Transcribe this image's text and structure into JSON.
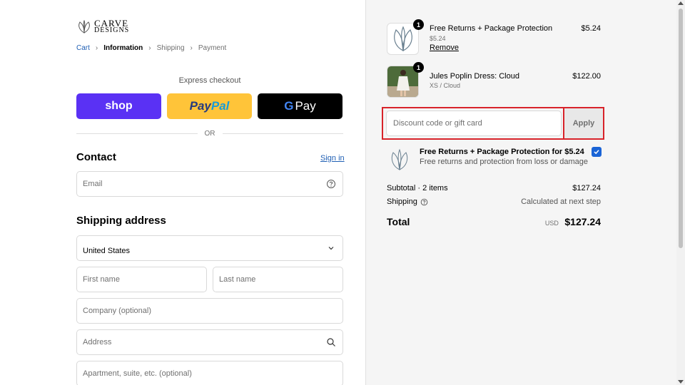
{
  "logo": {
    "line1": "CARVE",
    "line2": "DESIGNS"
  },
  "breadcrumb": [
    {
      "label": "Cart",
      "state": "link"
    },
    {
      "label": "Information",
      "state": "current"
    },
    {
      "label": "Shipping",
      "state": "inactive"
    },
    {
      "label": "Payment",
      "state": "inactive"
    }
  ],
  "express": {
    "label": "Express checkout",
    "shop": "shop",
    "paypal_a": "Pay",
    "paypal_b": "Pal",
    "gpay_g": "G",
    "gpay_text": "Pay",
    "or": "OR"
  },
  "contact": {
    "title": "Contact",
    "signin": "Sign in",
    "email_placeholder": "Email"
  },
  "shipping": {
    "title": "Shipping address",
    "country": "United States",
    "first_name_placeholder": "First name",
    "last_name_placeholder": "Last name",
    "company_placeholder": "Company (optional)",
    "address_placeholder": "Address",
    "apartment_placeholder": "Apartment, suite, etc. (optional)"
  },
  "cart": {
    "items": [
      {
        "title": "Free Returns + Package Protection",
        "sub": "$5.24",
        "action": "Remove",
        "price": "$5.24",
        "qty": "1",
        "icon": "leaf-logo-icon"
      },
      {
        "title": "Jules Poplin Dress: Cloud",
        "sub": "XS / Cloud",
        "price": "$122.00",
        "qty": "1",
        "icon": "dress-photo"
      }
    ],
    "discount_placeholder": "Discount code or gift card",
    "apply": "Apply",
    "protection_title": "Free Returns + Package Protection for $5.24",
    "protection_sub": "Free returns and protection from loss or damage",
    "subtotal_label": "Subtotal · 2 items",
    "subtotal_value": "$127.24",
    "shipping_label": "Shipping",
    "shipping_value": "Calculated at next step",
    "total_label": "Total",
    "total_currency": "USD",
    "total_value": "$127.24"
  },
  "colors": {
    "accent": "#1f5fb4",
    "shop": "#5a31f4",
    "paypal": "#ffc439",
    "highlight": "#d8232a",
    "checkbox": "#1a64d6"
  }
}
